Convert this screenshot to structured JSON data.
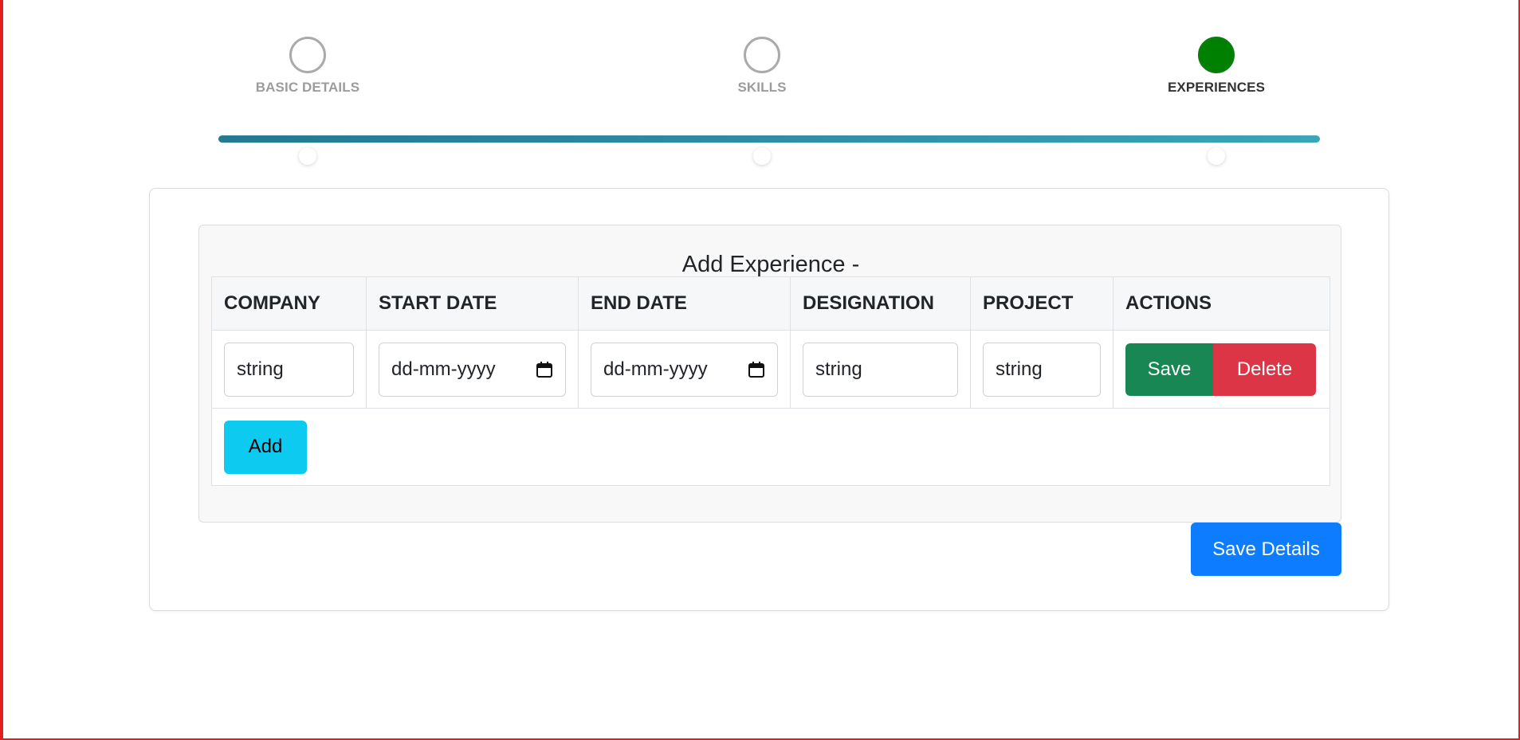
{
  "stepper": {
    "steps": [
      {
        "label": "BASIC DETAILS",
        "state": "inactive"
      },
      {
        "label": "SKILLS",
        "state": "inactive"
      },
      {
        "label": "EXPERIENCES",
        "state": "active"
      }
    ],
    "progress_fraction": 1.0,
    "colors": {
      "active": "#008000",
      "inactive": "#aaaaaa",
      "track": "#2f8da4"
    }
  },
  "form": {
    "title": "Add Experience -",
    "columns": [
      "COMPANY",
      "START DATE",
      "END DATE",
      "DESIGNATION",
      "PROJECT",
      "ACTIONS"
    ],
    "rows": [
      {
        "company": "string",
        "start_date": "dd-mm-yyyy",
        "end_date": "dd-mm-yyyy",
        "designation": "string",
        "project": "string",
        "save_label": "Save",
        "delete_label": "Delete"
      }
    ],
    "add_label": "Add",
    "save_details_label": "Save Details",
    "icons": {
      "date_picker": "calendar-icon"
    }
  },
  "colors": {
    "save": "#198754",
    "delete": "#dc3545",
    "add": "#0dcaf0",
    "save_details": "#0d7cff",
    "frame_border": "#e02020"
  }
}
